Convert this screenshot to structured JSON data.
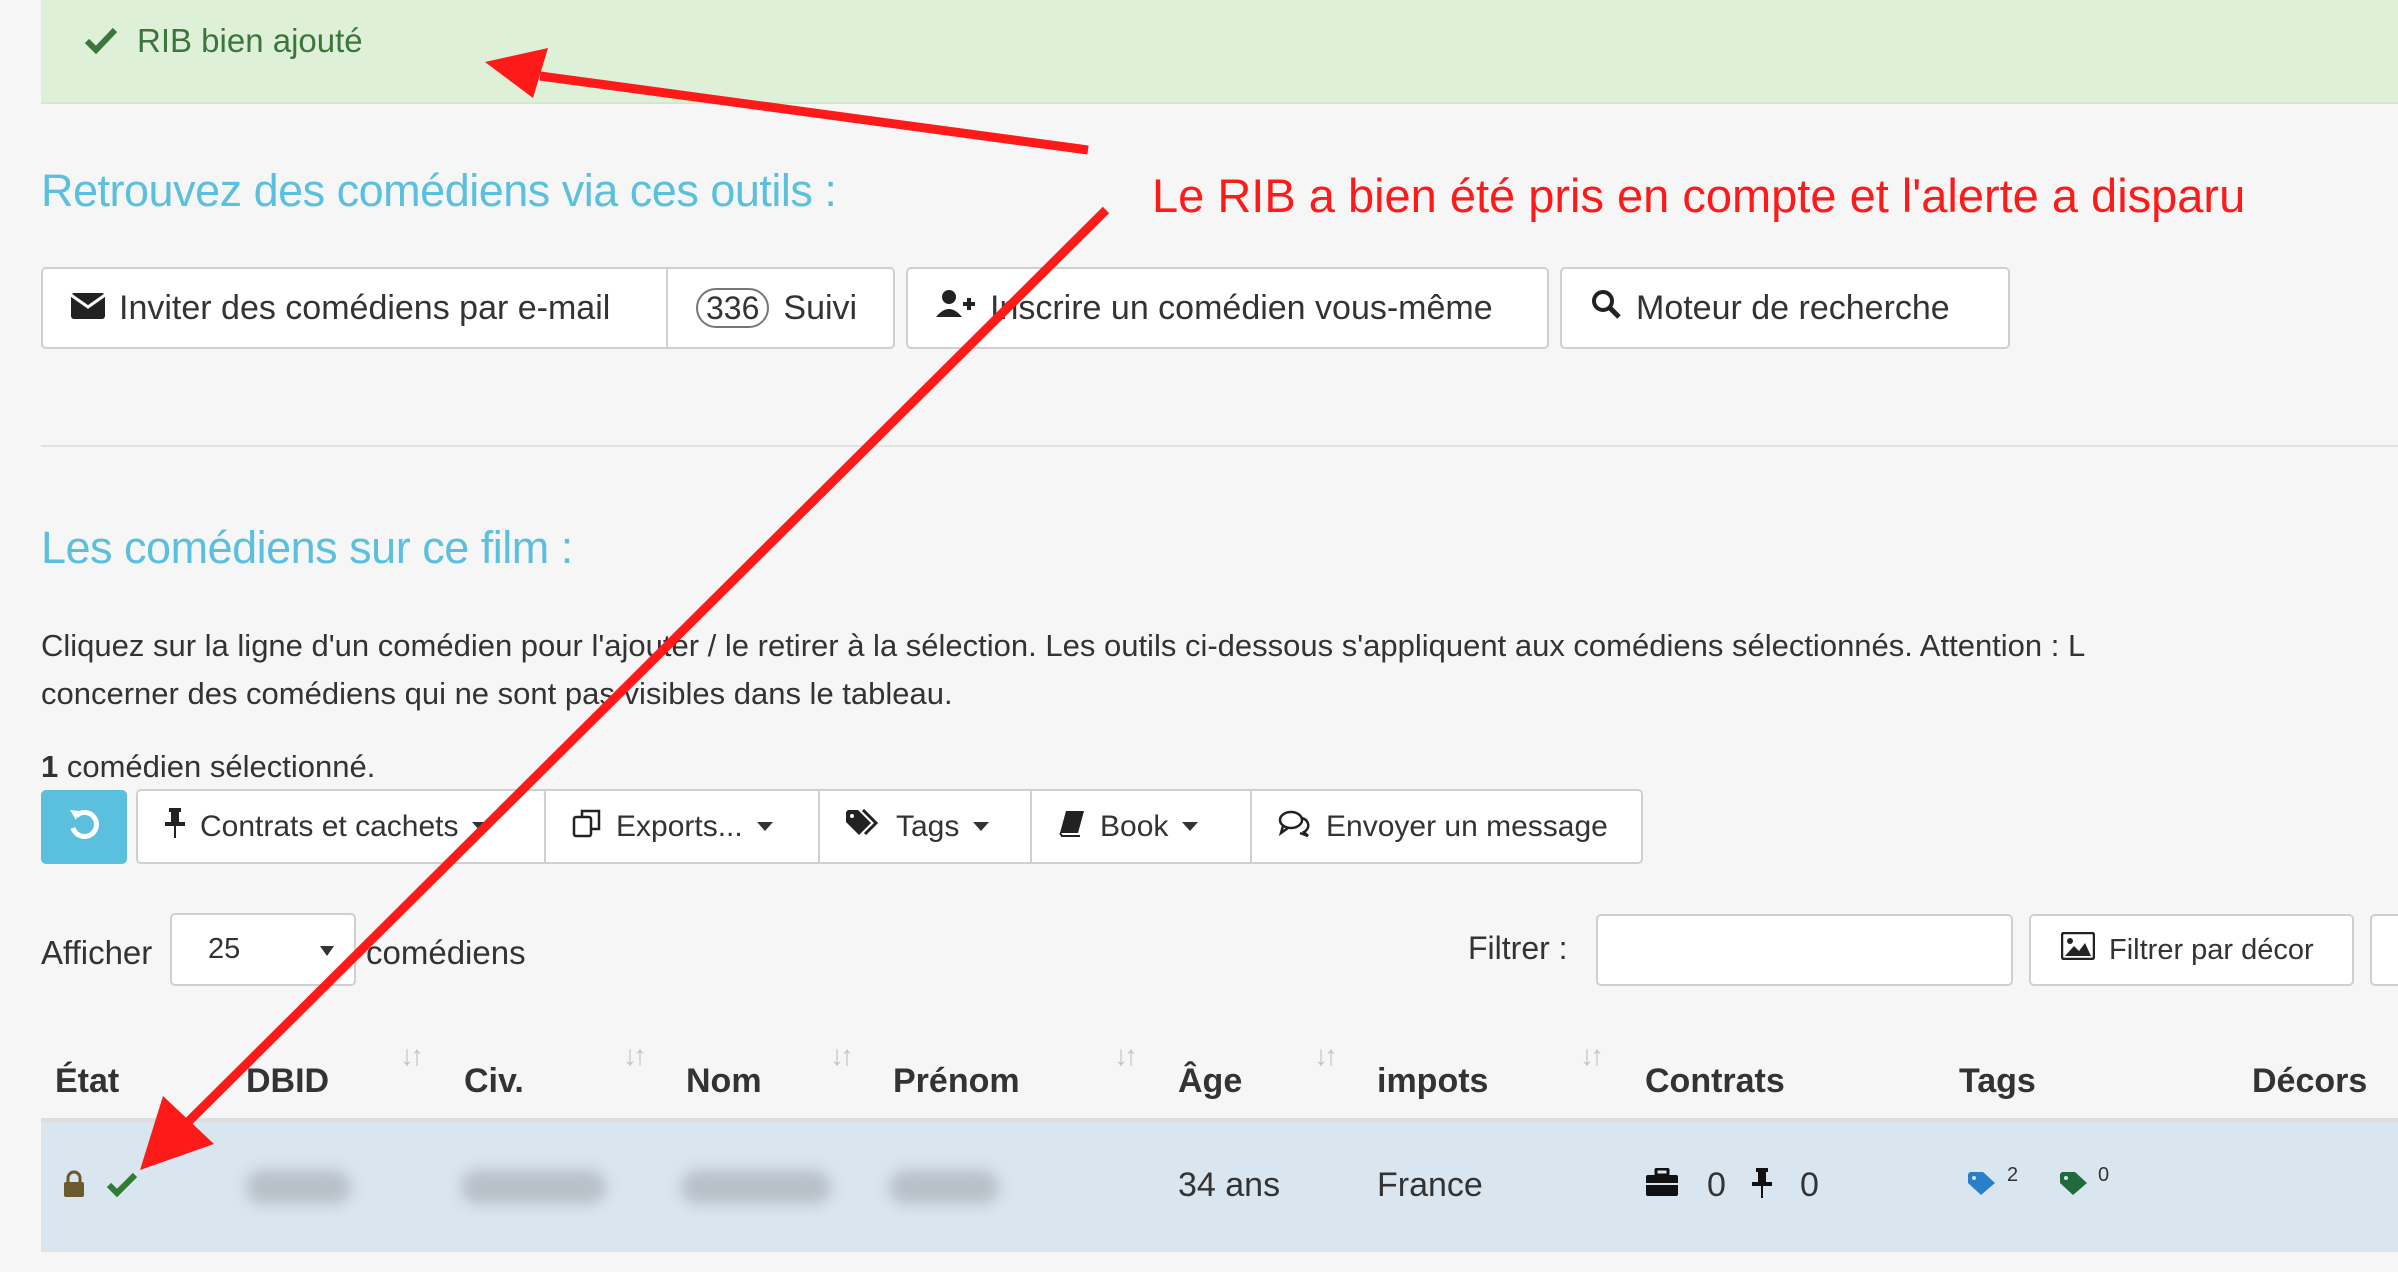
{
  "alert": {
    "text": "RIB bien ajouté",
    "color": "#3c763d",
    "bg": "#dff0d8"
  },
  "annotation": {
    "text": "Le RIB a bien été pris en compte et l'alerte a disparu",
    "color": "#ff1a1a"
  },
  "tools": {
    "title": "Retrouvez des comédiens via ces outils :",
    "invite_label": "Inviter des comédiens par e-mail",
    "follow_count": "336",
    "follow_label": "Suivi",
    "register_label": "Inscrire un comédien vous-même",
    "search_label": "Moteur de recherche"
  },
  "cast": {
    "title": "Les comédiens sur ce film :",
    "desc_line1": "Cliquez sur la ligne d'un comédien pour l'ajouter / le retirer à la sélection. Les outils ci-dessous s'appliquent aux comédiens sélectionnés. Attention : L",
    "desc_line2": "concerner des comédiens qui ne sont pas visibles dans le tableau.",
    "selected_count": "1",
    "selected_suffix": " comédien sélectionné.",
    "toolbar": {
      "contracts": "Contrats et cachets",
      "exports": "Exports...",
      "tags": "Tags",
      "book": "Book",
      "message": "Envoyer un message"
    },
    "show_label": "Afficher",
    "page_size": "25",
    "show_suffix": "comédiens",
    "filter_label": "Filtrer :",
    "filter_value": "",
    "decor_filter": "Filtrer par décor"
  },
  "table": {
    "headers": [
      "État",
      "DBID",
      "Civ.",
      "Nom",
      "Prénom",
      "Âge",
      "impots",
      "Contrats",
      "Tags",
      "Décors"
    ],
    "row": {
      "age": "34 ans",
      "impots": "France",
      "contracts_count": "0",
      "cachets_count": "0",
      "tag_count_1": "2",
      "tag_count_2": "0"
    }
  },
  "colors": {
    "accent": "#5bc0de",
    "row_selected": "#d9e5ef",
    "success": "#3c763d"
  }
}
